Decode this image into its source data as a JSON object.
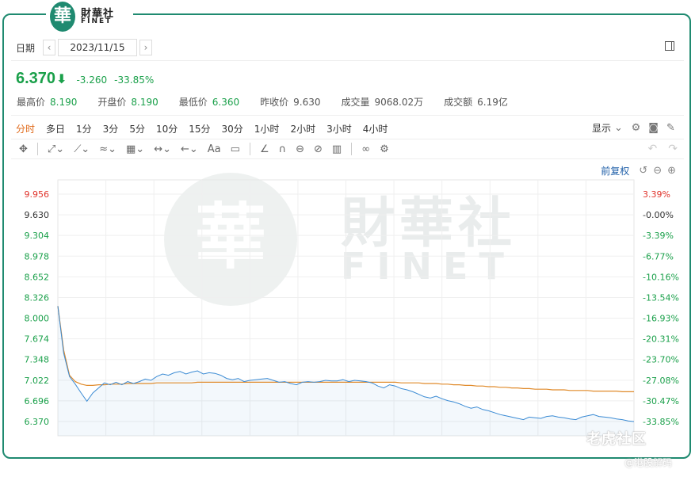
{
  "brand": {
    "mark": "華",
    "name_cn": "財華社",
    "name_en": "FINET"
  },
  "date_bar": {
    "label": "日期",
    "prev": "‹",
    "date": "2023/11/15",
    "next": "›"
  },
  "quote": {
    "price": "6.370",
    "arrow": "⬇",
    "change": "-3.260",
    "change_pct": "-33.85%",
    "stats": [
      {
        "label": "最高价",
        "value": "8.190",
        "color": "green"
      },
      {
        "label": "开盘价",
        "value": "8.190",
        "color": "green"
      },
      {
        "label": "最低价",
        "value": "6.360",
        "color": "green"
      },
      {
        "label": "昨收价",
        "value": "9.630",
        "color": "plain"
      },
      {
        "label": "成交量",
        "value": "9068.02万",
        "color": "plain"
      },
      {
        "label": "成交额",
        "value": "6.19亿",
        "color": "plain"
      }
    ]
  },
  "period_tabs": [
    "分时",
    "多日",
    "1分",
    "3分",
    "5分",
    "10分",
    "15分",
    "30分",
    "1小时",
    "2小时",
    "3小时",
    "4小时"
  ],
  "active_tab": "分时",
  "display_menu": "显示",
  "adjust_label": "前复权",
  "watermark": {
    "cn": "財華社",
    "en": "FINET",
    "mark": "華"
  },
  "corner_watermark": {
    "line1": "老虎社区",
    "line2": "@港股解码"
  },
  "colors": {
    "up": "#e0332b",
    "down": "#1aa04a",
    "price_line": "#3b8bd4",
    "avg_line": "#e08a2a",
    "brand": "#1f8a70",
    "active_tab": "#e06a1a"
  },
  "chart_data": {
    "type": "line",
    "title": "",
    "prev_close": 9.63,
    "y_ticks_left": [
      "9.956",
      "9.630",
      "9.304",
      "8.978",
      "8.652",
      "8.326",
      "8.000",
      "7.674",
      "7.348",
      "7.022",
      "6.696",
      "6.370"
    ],
    "y_ticks_right": [
      "3.39%",
      "-0.00%",
      "-3.39%",
      "-6.77%",
      "-10.16%",
      "-13.54%",
      "-16.93%",
      "-20.31%",
      "-23.70%",
      "-27.08%",
      "-30.47%",
      "-33.85%"
    ],
    "ylim": [
      6.37,
      9.956
    ],
    "x_count": 100,
    "series": [
      {
        "name": "",
        "values": [
          8.19,
          7.45,
          7.08,
          6.96,
          6.82,
          6.69,
          6.82,
          6.9,
          6.98,
          6.95,
          6.99,
          6.95,
          7.0,
          6.97,
          7.0,
          7.04,
          7.02,
          7.08,
          7.12,
          7.1,
          7.14,
          7.16,
          7.12,
          7.15,
          7.17,
          7.12,
          7.14,
          7.13,
          7.1,
          7.05,
          7.03,
          7.05,
          7.0,
          7.02,
          7.03,
          7.04,
          7.05,
          7.02,
          6.99,
          7.0,
          6.97,
          6.95,
          6.99,
          7.0,
          6.99,
          7.0,
          7.02,
          7.01,
          7.01,
          7.03,
          7.0,
          7.02,
          7.01,
          7.0,
          6.98,
          6.93,
          6.9,
          6.95,
          6.93,
          6.89,
          6.87,
          6.84,
          6.8,
          6.76,
          6.74,
          6.77,
          6.73,
          6.7,
          6.68,
          6.65,
          6.61,
          6.58,
          6.6,
          6.56,
          6.54,
          6.51,
          6.48,
          6.46,
          6.44,
          6.42,
          6.4,
          6.44,
          6.43,
          6.42,
          6.45,
          6.46,
          6.44,
          6.43,
          6.41,
          6.4,
          6.44,
          6.46,
          6.48,
          6.45,
          6.44,
          6.43,
          6.41,
          6.4,
          6.38,
          6.37
        ]
      },
      {
        "name": "",
        "values": [
          8.19,
          7.5,
          7.1,
          7.0,
          6.96,
          6.94,
          6.94,
          6.95,
          6.95,
          6.96,
          6.96,
          6.96,
          6.97,
          6.97,
          6.97,
          6.97,
          6.97,
          6.98,
          6.98,
          6.98,
          6.98,
          6.98,
          6.98,
          6.98,
          6.99,
          6.99,
          6.99,
          6.99,
          6.99,
          6.99,
          6.99,
          6.99,
          6.99,
          6.99,
          6.99,
          6.99,
          6.99,
          6.99,
          6.99,
          6.99,
          6.99,
          6.99,
          6.99,
          6.99,
          6.99,
          6.99,
          6.99,
          6.99,
          6.99,
          6.99,
          6.99,
          6.99,
          6.99,
          6.99,
          6.99,
          6.99,
          6.99,
          6.99,
          6.99,
          6.98,
          6.98,
          6.98,
          6.98,
          6.97,
          6.97,
          6.97,
          6.96,
          6.96,
          6.95,
          6.95,
          6.94,
          6.94,
          6.93,
          6.93,
          6.92,
          6.92,
          6.91,
          6.91,
          6.9,
          6.9,
          6.89,
          6.89,
          6.88,
          6.88,
          6.88,
          6.87,
          6.87,
          6.87,
          6.86,
          6.86,
          6.86,
          6.86,
          6.85,
          6.85,
          6.85,
          6.85,
          6.85,
          6.84,
          6.84,
          6.84
        ]
      }
    ]
  }
}
